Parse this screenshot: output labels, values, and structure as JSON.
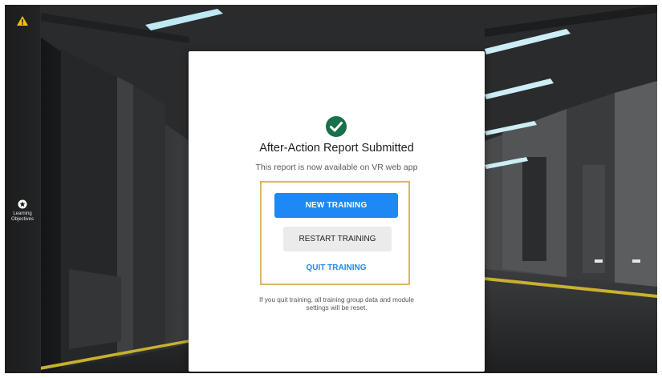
{
  "sidebar": {
    "logo_icon": "warning-triangle-icon",
    "learning_objectives": {
      "icon": "star-badge-icon",
      "label_line1": "Learning",
      "label_line2": "Objectives"
    }
  },
  "modal": {
    "status_icon": "check-circle-icon",
    "title": "After-Action Report Submitted",
    "subtitle": "This report is now available on VR web app",
    "buttons": {
      "new_training": "NEW TRAINING",
      "restart_training": "RESTART TRAINING",
      "quit_training": "QUIT TRAINING"
    },
    "note_line1": "If you quit training, all training group data and module",
    "note_line2": "settings will be reset."
  },
  "colors": {
    "primary": "#1e88f5",
    "success": "#19704a",
    "highlight_border": "#e1b467",
    "logo": "#f2c300"
  }
}
